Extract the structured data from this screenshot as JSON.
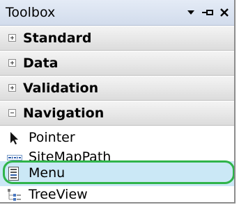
{
  "toolbox": {
    "title": "Toolbox",
    "sections": [
      {
        "label": "Standard",
        "expanded": false
      },
      {
        "label": "Data",
        "expanded": false
      },
      {
        "label": "Validation",
        "expanded": false
      },
      {
        "label": "Navigation",
        "expanded": true
      }
    ],
    "navigation_items": [
      {
        "label": "Pointer",
        "icon": "pointer-arrow-icon"
      },
      {
        "label": "SiteMapPath",
        "icon": "sitemappath-icon"
      },
      {
        "label": "Menu",
        "icon": "menu-control-icon",
        "selected": true
      },
      {
        "label": "TreeView",
        "icon": "treeview-icon"
      }
    ]
  },
  "colors": {
    "selection_background": "#cbe8f6",
    "highlight_outline": "#2fb44a"
  }
}
